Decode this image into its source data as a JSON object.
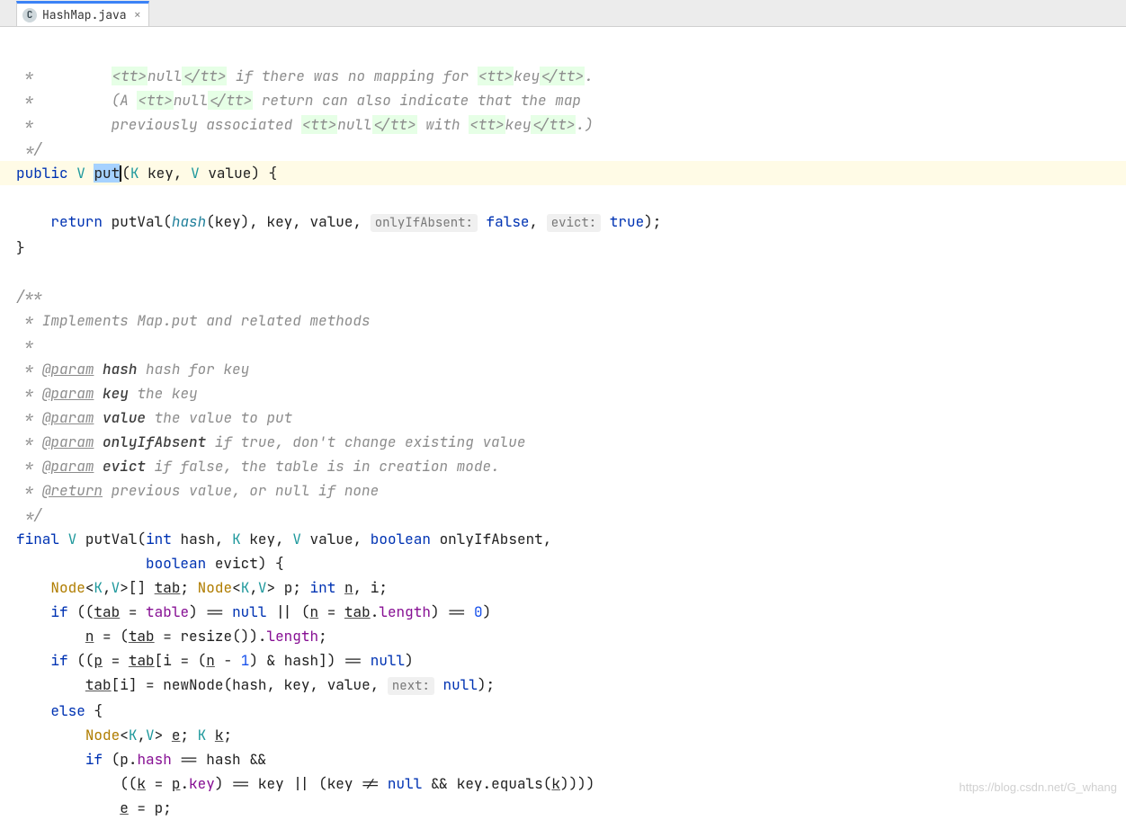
{
  "tab": {
    "icon_letter": "C",
    "filename": "HashMap.java"
  },
  "watermark": "https://blog.csdn.net/G_whang",
  "code": {
    "c1a": " *         ",
    "c1_tt1": "<tt>",
    "c1_null": "null",
    "c1_tt2": "</tt>",
    "c1_mid": " if there was no mapping for ",
    "c1_tt3": "<tt>",
    "c1_key": "key",
    "c1_tt4": "</tt>",
    "c1_dot": ".",
    "c2a": " *         (A ",
    "c2_tt1": "<tt>",
    "c2_null": "null",
    "c2_tt2": "</tt>",
    "c2_rest": " return can also indicate that the map",
    "c3a": " *         previously associated ",
    "c3_tt1": "<tt>",
    "c3_null": "null",
    "c3_tt2": "</tt>",
    "c3_with": " with ",
    "c3_tt3": "<tt>",
    "c3_key": "key",
    "c3_tt4": "</tt>",
    "c3_end": ".)",
    "c4": " */",
    "put_public": "public",
    "put_V": "V",
    "put_name": "put",
    "put_K": "K",
    "put_key": "key",
    "put_Vp": "V",
    "put_value": "value",
    "ret": "return",
    "putVal": "putVal",
    "hash": "hash",
    "ret_key": "key",
    "ret_value": "value",
    "h_onlyIf": "onlyIfAbsent:",
    "ret_false": "false",
    "h_evict": "evict:",
    "ret_true": "true",
    "doc_start": "/**",
    "doc_impl": " * Implements Map.put and related methods",
    "doc_blank": " *",
    "tag_param": "@param",
    "p_hash": "hash",
    "p_hash_d": "hash for key",
    "p_key": "key",
    "p_key_d": "the key",
    "p_value": "value",
    "p_value_d": "the value to put",
    "p_oia": "onlyIfAbsent",
    "p_oia_d": "if true, don't change existing value",
    "p_evict": "evict",
    "p_evict_d": "if false, the table is in creation mode.",
    "tag_return": "@return",
    "p_ret_d": "previous value, or null if none",
    "doc_end": " */",
    "pv_final": "final",
    "pv_V": "V",
    "pv_name": "putVal",
    "pv_int": "int",
    "pv_hash": "hash",
    "pv_K": "K",
    "pv_key": "key",
    "pv_Vp": "V",
    "pv_value": "value",
    "pv_bool1": "boolean",
    "pv_oia": "onlyIfAbsent",
    "pv_bool2": "boolean",
    "pv_evict": "evict",
    "node": "Node",
    "tab_var": "tab",
    "p_var": "p",
    "n_var": "n",
    "i_var": "i",
    "if": "if",
    "table": "table",
    "null": "null",
    "length": "length",
    "zero": "0",
    "resize": "resize",
    "one": "1",
    "newNode": "newNode",
    "h_next": "next:",
    "else": "else",
    "e_var": "e",
    "k_var": "k",
    "equals": "equals",
    "int_kw": "int"
  }
}
